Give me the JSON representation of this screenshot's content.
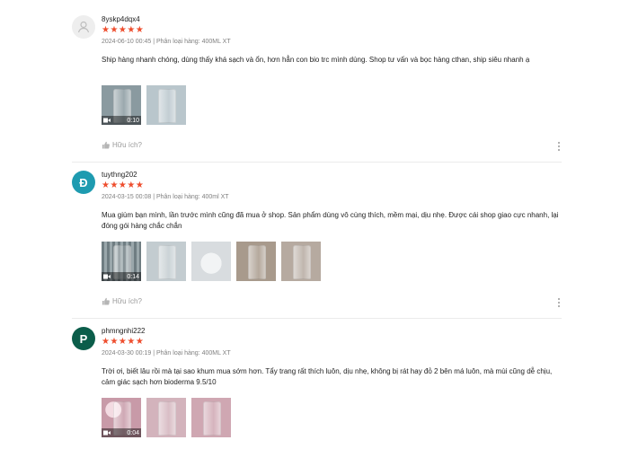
{
  "reviews": [
    {
      "avatar_letter": "",
      "avatar_color": "#eeeeee",
      "username": "8yskp4dqx4",
      "rating": 5,
      "stars": "★★★★★",
      "meta": "2024-06-10 00:45 | Phân loại hàng: 400ML XT",
      "comment": "Ship hàng nhanh chóng, dùng thấy khá sạch và ổn, hơn hẳn con bio trc mình dùng. Shop tư vấn và bọc hàng cthan, ship siêu nhanh ạ",
      "media": [
        {
          "type": "video",
          "duration": "0:10",
          "color": "#8a9aa0"
        },
        {
          "type": "image",
          "color": "#b9c6cc"
        }
      ],
      "helpful_label": "Hữu ích?"
    },
    {
      "avatar_letter": "Đ",
      "avatar_color": "#1e9bb0",
      "username": "tuythng202",
      "rating": 5,
      "stars": "★★★★★",
      "meta": "2024-03-15 00:08 | Phân loại hàng: 400ml XT",
      "comment": "Mua giùm bạn mình, lần trước mình cũng đã mua ở shop. Sản phẩm dùng vô cùng thích, mềm mại, dịu nhẹ. Được cái shop giao cực nhanh, lại đóng gói hàng chắc chắn",
      "media": [
        {
          "type": "video",
          "duration": "0:14",
          "color": "#7d8b90"
        },
        {
          "type": "image",
          "color": "#c3ccd0"
        },
        {
          "type": "image",
          "color": "#d8dcdf"
        },
        {
          "type": "image",
          "color": "#a89a8c"
        },
        {
          "type": "image",
          "color": "#b6aaa0"
        }
      ],
      "helpful_label": "Hữu ích?"
    },
    {
      "avatar_letter": "P",
      "avatar_color": "#0b5d4a",
      "username": "phmngnhi222",
      "rating": 5,
      "stars": "★★★★★",
      "meta": "2024-03-30 00:19 | Phân loại hàng: 400ML XT",
      "comment": "Trời ơi, biết lâu rồi mà tại sao khum mua sớm hơn. Tẩy trang rất thích luôn, dịu nhẹ, không bị rát hay đỏ 2 bên má luôn, mà mùi cũng dễ chịu, cảm giác sạch hơn bioderma 9.5/10",
      "media": [
        {
          "type": "video",
          "duration": "0:04",
          "color": "#c89aa8"
        },
        {
          "type": "image",
          "color": "#d3b3bc"
        },
        {
          "type": "image",
          "color": "#cfa7b2"
        }
      ],
      "helpful_label": ""
    }
  ],
  "colors": {
    "star": "#ee4d2d",
    "meta": "#808080",
    "helpful": "#9a9a9a"
  }
}
